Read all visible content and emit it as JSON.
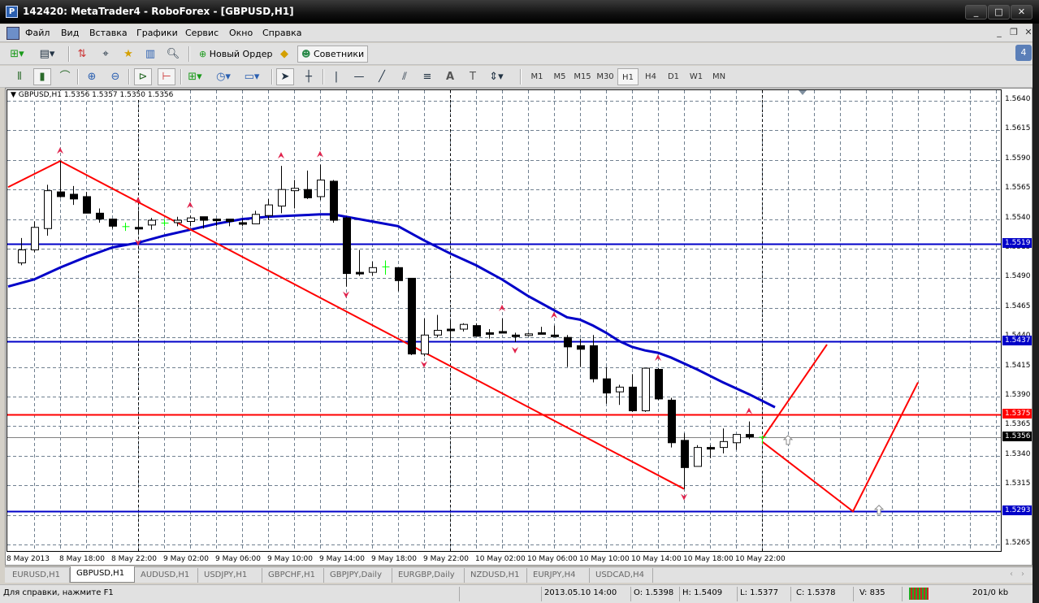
{
  "window": {
    "title": "142420: MetaTrader4 - RoboForex - [GBPUSD,H1]",
    "app_icon": "mt4-icon"
  },
  "menu": {
    "items": [
      "Файл",
      "Вид",
      "Вставка",
      "Графики",
      "Сервис",
      "Окно",
      "Справка"
    ]
  },
  "toolbar1": {
    "new_order_label": "Новый Ордер",
    "experts_label": "Советники",
    "notifications_count": "4"
  },
  "toolbar2": {
    "periods": [
      "M1",
      "M5",
      "M15",
      "M30",
      "H1",
      "H4",
      "D1",
      "W1",
      "MN"
    ],
    "active_period": "H1"
  },
  "chart": {
    "header": "GBPUSD,H1  1.5356 1.5357 1.5350 1.5356",
    "colors": {
      "bull_fill": "#ffffff",
      "bear_fill": "#000000",
      "doji": "#00ff00",
      "ma": "#0000c8",
      "zigzag": "#ff0000",
      "level_blue": "#0000c8",
      "level_red": "#ff0000",
      "fractal": "#e0204a",
      "grid": "#708090"
    },
    "price_axis": [
      "1.5640",
      "1.5615",
      "1.5590",
      "1.5565",
      "1.5540",
      "1.5515",
      "1.5490",
      "1.5465",
      "1.5440",
      "1.5415",
      "1.5390",
      "1.5365",
      "1.5340",
      "1.5315",
      "1.5290",
      "1.5265"
    ],
    "price_range": [
      1.52535,
      1.56489
    ],
    "levels": [
      {
        "price": 1.5519,
        "label": "1.5519",
        "color": "#0000c8"
      },
      {
        "price": 1.5437,
        "label": "1.5437",
        "color": "#0000c8"
      },
      {
        "price": 1.5375,
        "label": "1.5375",
        "color": "#ff0000"
      },
      {
        "price": 1.5356,
        "label": "1.5356",
        "color": "#000000",
        "kind": "bid"
      },
      {
        "price": 1.5293,
        "label": "1.5293",
        "color": "#0000c8"
      }
    ],
    "time_axis": [
      {
        "bar": 0,
        "text": "8 May 2013"
      },
      {
        "bar": 3,
        "text": "8 May 18:00"
      },
      {
        "bar": 7,
        "text": "8 May 22:00"
      },
      {
        "bar": 11,
        "text": "9 May 02:00"
      },
      {
        "bar": 15,
        "text": "9 May 06:00"
      },
      {
        "bar": 19,
        "text": "9 May 10:00"
      },
      {
        "bar": 23,
        "text": "9 May 14:00"
      },
      {
        "bar": 27,
        "text": "9 May 18:00"
      },
      {
        "bar": 31,
        "text": "9 May 22:00"
      },
      {
        "bar": 35,
        "text": "10 May 02:00"
      },
      {
        "bar": 39,
        "text": "10 May 06:00"
      },
      {
        "bar": 43,
        "text": "10 May 10:00"
      },
      {
        "bar": 47,
        "text": "10 May 14:00"
      },
      {
        "bar": 51,
        "text": "10 May 18:00"
      },
      {
        "bar": 55,
        "text": "10 May 22:00"
      }
    ],
    "period_separators": [
      9,
      33,
      57
    ],
    "candles": [
      [
        1.5503,
        1.5524,
        1.5501,
        1.5514
      ],
      [
        1.5514,
        1.5538,
        1.5512,
        1.5533
      ],
      [
        1.5532,
        1.5569,
        1.5526,
        1.5564
      ],
      [
        1.5563,
        1.5589,
        1.5558,
        1.5559
      ],
      [
        1.5561,
        1.5568,
        1.5552,
        1.5557
      ],
      [
        1.5559,
        1.5563,
        1.5545,
        1.5545
      ],
      [
        1.5545,
        1.5549,
        1.5537,
        1.554
      ],
      [
        1.554,
        1.554,
        1.5532,
        1.5534
      ],
      [
        1.5534,
        1.5537,
        1.553,
        1.5534
      ],
      [
        1.5533,
        1.5547,
        1.5527,
        1.5532
      ],
      [
        1.5535,
        1.5541,
        1.5531,
        1.5539
      ],
      [
        1.5537,
        1.554,
        1.5534,
        1.5537
      ],
      [
        1.5537,
        1.5542,
        1.5534,
        1.5539
      ],
      [
        1.5538,
        1.5543,
        1.5534,
        1.5541
      ],
      [
        1.5542,
        1.5542,
        1.5532,
        1.5539
      ],
      [
        1.554,
        1.554,
        1.5534,
        1.5539
      ],
      [
        1.554,
        1.554,
        1.5534,
        1.5538
      ],
      [
        1.5537,
        1.554,
        1.5534,
        1.5536
      ],
      [
        1.5536,
        1.5547,
        1.5536,
        1.5544
      ],
      [
        1.5543,
        1.5557,
        1.5539,
        1.5552
      ],
      [
        1.5551,
        1.5585,
        1.5545,
        1.5565
      ],
      [
        1.5564,
        1.5573,
        1.5549,
        1.5566
      ],
      [
        1.5565,
        1.5581,
        1.5557,
        1.5558
      ],
      [
        1.5559,
        1.5586,
        1.5556,
        1.5573
      ],
      [
        1.5572,
        1.5573,
        1.5537,
        1.5539
      ],
      [
        1.5541,
        1.5542,
        1.5483,
        1.5494
      ],
      [
        1.5495,
        1.5514,
        1.5492,
        1.5494
      ],
      [
        1.5495,
        1.5504,
        1.5492,
        1.5499
      ],
      [
        1.55,
        1.5505,
        1.5493,
        1.55
      ],
      [
        1.5499,
        1.5499,
        1.5479,
        1.5488
      ],
      [
        1.549,
        1.549,
        1.5425,
        1.5426
      ],
      [
        1.5426,
        1.5456,
        1.5424,
        1.5442
      ],
      [
        1.5442,
        1.5459,
        1.544,
        1.5446
      ],
      [
        1.5447,
        1.5454,
        1.5438,
        1.5446
      ],
      [
        1.5447,
        1.5452,
        1.5445,
        1.5451
      ],
      [
        1.545,
        1.5452,
        1.5441,
        1.5441
      ],
      [
        1.5444,
        1.5447,
        1.5439,
        1.5443
      ],
      [
        1.5445,
        1.5456,
        1.5444,
        1.5444
      ],
      [
        1.5442,
        1.5444,
        1.5436,
        1.5441
      ],
      [
        1.5442,
        1.5444,
        1.5441,
        1.5443
      ],
      [
        1.5444,
        1.5449,
        1.5443,
        1.5443
      ],
      [
        1.5442,
        1.545,
        1.5441,
        1.5441
      ],
      [
        1.544,
        1.5442,
        1.5415,
        1.5432
      ],
      [
        1.5433,
        1.5439,
        1.5415,
        1.543
      ],
      [
        1.5433,
        1.5442,
        1.5402,
        1.5405
      ],
      [
        1.5405,
        1.5415,
        1.5384,
        1.5393
      ],
      [
        1.5394,
        1.54,
        1.5383,
        1.5398
      ],
      [
        1.5398,
        1.5409,
        1.5377,
        1.5378
      ],
      [
        1.5378,
        1.5414,
        1.5377,
        1.5414
      ],
      [
        1.5413,
        1.5414,
        1.5387,
        1.5388
      ],
      [
        1.5387,
        1.5389,
        1.5347,
        1.5351
      ],
      [
        1.5353,
        1.5359,
        1.5312,
        1.533
      ],
      [
        1.5331,
        1.5349,
        1.5331,
        1.5347
      ],
      [
        1.5347,
        1.5349,
        1.5338,
        1.5346
      ],
      [
        1.5347,
        1.5363,
        1.5342,
        1.5352
      ],
      [
        1.5351,
        1.5358,
        1.5345,
        1.5358
      ],
      [
        1.5358,
        1.5369,
        1.5354,
        1.5356
      ],
      [
        1.5356,
        1.5357,
        1.535,
        1.5356
      ]
    ],
    "moving_average": [
      [
        -1,
        1.5483
      ],
      [
        1,
        1.5489
      ],
      [
        3,
        1.5499
      ],
      [
        5,
        1.5508
      ],
      [
        7,
        1.5516
      ],
      [
        9,
        1.552
      ],
      [
        11,
        1.5526
      ],
      [
        13,
        1.5531
      ],
      [
        15,
        1.5536
      ],
      [
        17,
        1.554
      ],
      [
        19,
        1.5542
      ],
      [
        21,
        1.5543
      ],
      [
        23,
        1.5544
      ],
      [
        24,
        1.5544
      ],
      [
        25,
        1.5542
      ],
      [
        27,
        1.5538
      ],
      [
        29,
        1.5534
      ],
      [
        31,
        1.5522
      ],
      [
        33,
        1.5511
      ],
      [
        35,
        1.5501
      ],
      [
        37,
        1.5489
      ],
      [
        39,
        1.5475
      ],
      [
        41,
        1.5463
      ],
      [
        42,
        1.5457
      ],
      [
        43,
        1.5455
      ],
      [
        44,
        1.545
      ],
      [
        45,
        1.5444
      ],
      [
        46,
        1.5437
      ],
      [
        47,
        1.5432
      ],
      [
        48,
        1.5429
      ],
      [
        49,
        1.5427
      ],
      [
        50,
        1.5423
      ],
      [
        52,
        1.5413
      ],
      [
        54,
        1.5402
      ],
      [
        56,
        1.5392
      ],
      [
        58,
        1.5381
      ]
    ],
    "zigzag": [
      [
        -1,
        1.5567
      ],
      [
        3,
        1.5589
      ],
      [
        51,
        1.5312
      ]
    ],
    "projections": [
      [
        [
          57,
          1.5354
        ],
        [
          62,
          1.5434
        ]
      ],
      [
        [
          57,
          1.5352
        ],
        [
          64,
          1.5293
        ],
        [
          69,
          1.5402
        ]
      ]
    ],
    "projection_markers": [
      [
        58,
        1.5353
      ],
      [
        65,
        1.5294
      ]
    ],
    "fractals_up": [
      [
        3,
        1.5589
      ],
      [
        9,
        1.5547
      ],
      [
        13,
        1.5543
      ],
      [
        20,
        1.5585
      ],
      [
        23,
        1.5586
      ],
      [
        37,
        1.5456
      ],
      [
        41,
        1.545
      ],
      [
        49,
        1.5414
      ],
      [
        56,
        1.5369
      ]
    ],
    "fractals_down": [
      [
        9,
        1.5527
      ],
      [
        25,
        1.5483
      ],
      [
        31,
        1.5424
      ],
      [
        38,
        1.5436
      ],
      [
        51,
        1.5312
      ]
    ]
  },
  "tabs": [
    "EURUSD,H1",
    "GBPUSD,H1",
    "AUDUSD,H1",
    "USDJPY,H1",
    "GBPCHF,H1",
    "GBPJPY,Daily",
    "EURGBP,Daily",
    "NZDUSD,H1",
    "EURJPY,H4",
    "USDCAD,H4"
  ],
  "active_tab": "GBPUSD,H1",
  "status": {
    "help": "Для справки, нажмите F1",
    "time": "2013.05.10 14:00",
    "open": "O: 1.5398",
    "high": "H: 1.5409",
    "low": "L: 1.5377",
    "close": "C: 1.5378",
    "volume": "V: 835",
    "traffic": "201/0 kb"
  }
}
